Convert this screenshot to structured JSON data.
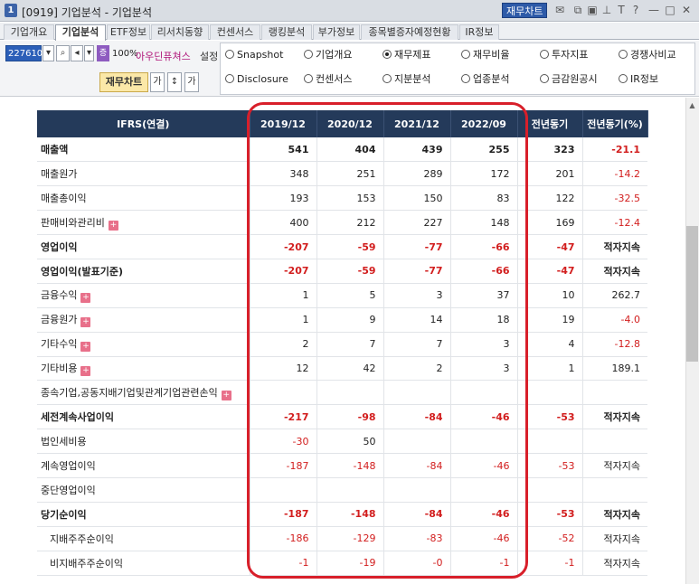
{
  "titlebar": {
    "number": "1",
    "title": "[0919] 기업분석 - 기업분석",
    "chart_button": "재무차트",
    "icons": [
      "mail-icon",
      "copy-icon",
      "window-icon",
      "pin-icon",
      "text-icon",
      "help-icon",
      "minimize-icon",
      "maximize-icon",
      "close-icon"
    ]
  },
  "tabs": [
    "기업개요",
    "기업분석",
    "ETF정보",
    "리서치동향",
    "컨센서스",
    "랭킹분석",
    "부가정보",
    "종목별증자예정현황",
    "IR정보"
  ],
  "toolbar": {
    "stock_code": "227610",
    "purple_tag": "증",
    "zoom": "100%",
    "stock_name": "아우딘퓨쳐스",
    "setting": "설정",
    "fin_chart_button": "재무차트",
    "small_btn_1": "가",
    "small_btn_2": "↕",
    "small_btn_3": "가"
  },
  "radios": [
    {
      "label": "Snapshot",
      "checked": false
    },
    {
      "label": "기업개요",
      "checked": false
    },
    {
      "label": "재무제표",
      "checked": true
    },
    {
      "label": "재무비율",
      "checked": false
    },
    {
      "label": "투자지표",
      "checked": false
    },
    {
      "label": "경쟁사비교",
      "checked": false
    },
    {
      "label": "Disclosure",
      "checked": false
    },
    {
      "label": "컨센서스",
      "checked": false
    },
    {
      "label": "지분분석",
      "checked": false
    },
    {
      "label": "업종분석",
      "checked": false
    },
    {
      "label": "금감원공시",
      "checked": false
    },
    {
      "label": "IR정보",
      "checked": false
    }
  ],
  "table": {
    "headers": [
      "IFRS(연결)",
      "2019/12",
      "2020/12",
      "2021/12",
      "2022/09",
      "전년동기",
      "전년동기(%)"
    ],
    "rows": [
      {
        "label": "매출액",
        "bold": true,
        "plus": false,
        "sub": false,
        "values": [
          "541",
          "404",
          "439",
          "255",
          "323",
          "-21.1"
        ]
      },
      {
        "label": "매출원가",
        "bold": false,
        "plus": false,
        "sub": false,
        "values": [
          "348",
          "251",
          "289",
          "172",
          "201",
          "-14.2"
        ]
      },
      {
        "label": "매출총이익",
        "bold": false,
        "plus": false,
        "sub": false,
        "values": [
          "193",
          "153",
          "150",
          "83",
          "122",
          "-32.5"
        ]
      },
      {
        "label": "판매비와관리비",
        "bold": false,
        "plus": true,
        "sub": false,
        "values": [
          "400",
          "212",
          "227",
          "148",
          "169",
          "-12.4"
        ]
      },
      {
        "label": "영업이익",
        "bold": true,
        "plus": false,
        "sub": false,
        "values": [
          "-207",
          "-59",
          "-77",
          "-66",
          "-47",
          "적자지속"
        ]
      },
      {
        "label": "영업이익(발표기준)",
        "bold": true,
        "plus": false,
        "sub": false,
        "values": [
          "-207",
          "-59",
          "-77",
          "-66",
          "-47",
          "적자지속"
        ]
      },
      {
        "label": "금융수익",
        "bold": false,
        "plus": true,
        "sub": false,
        "values": [
          "1",
          "5",
          "3",
          "37",
          "10",
          "262.7"
        ]
      },
      {
        "label": "금융원가",
        "bold": false,
        "plus": true,
        "sub": false,
        "values": [
          "1",
          "9",
          "14",
          "18",
          "19",
          "-4.0"
        ]
      },
      {
        "label": "기타수익",
        "bold": false,
        "plus": true,
        "sub": false,
        "values": [
          "2",
          "7",
          "7",
          "3",
          "4",
          "-12.8"
        ]
      },
      {
        "label": "기타비용",
        "bold": false,
        "plus": true,
        "sub": false,
        "values": [
          "12",
          "42",
          "2",
          "3",
          "1",
          "189.1"
        ]
      },
      {
        "label": "종속기업,공동지배기업및관계기업관련손익",
        "bold": false,
        "plus": true,
        "sub": false,
        "values": [
          "",
          "",
          "",
          "",
          "",
          ""
        ]
      },
      {
        "label": "세전계속사업이익",
        "bold": true,
        "plus": false,
        "sub": false,
        "values": [
          "-217",
          "-98",
          "-84",
          "-46",
          "-53",
          "적자지속"
        ]
      },
      {
        "label": "법인세비용",
        "bold": false,
        "plus": false,
        "sub": false,
        "values": [
          "-30",
          "50",
          "",
          "",
          "",
          ""
        ]
      },
      {
        "label": "계속영업이익",
        "bold": false,
        "plus": false,
        "sub": false,
        "values": [
          "-187",
          "-148",
          "-84",
          "-46",
          "-53",
          "적자지속"
        ]
      },
      {
        "label": "중단영업이익",
        "bold": false,
        "plus": false,
        "sub": false,
        "values": [
          "",
          "",
          "",
          "",
          "",
          ""
        ]
      },
      {
        "label": "당기순이익",
        "bold": true,
        "plus": false,
        "sub": false,
        "values": [
          "-187",
          "-148",
          "-84",
          "-46",
          "-53",
          "적자지속"
        ]
      },
      {
        "label": "지배주주순이익",
        "bold": false,
        "plus": false,
        "sub": true,
        "values": [
          "-186",
          "-129",
          "-83",
          "-46",
          "-52",
          "적자지속"
        ]
      },
      {
        "label": "비지배주주순이익",
        "bold": false,
        "plus": false,
        "sub": true,
        "values": [
          "-1",
          "-19",
          "-0",
          "-1",
          "-1",
          "적자지속"
        ]
      }
    ]
  },
  "colors": {
    "header_bg": "#243a5a",
    "negative": "#d21e1e",
    "highlight": "#d81f2a",
    "accent": "#2d5aa8"
  }
}
